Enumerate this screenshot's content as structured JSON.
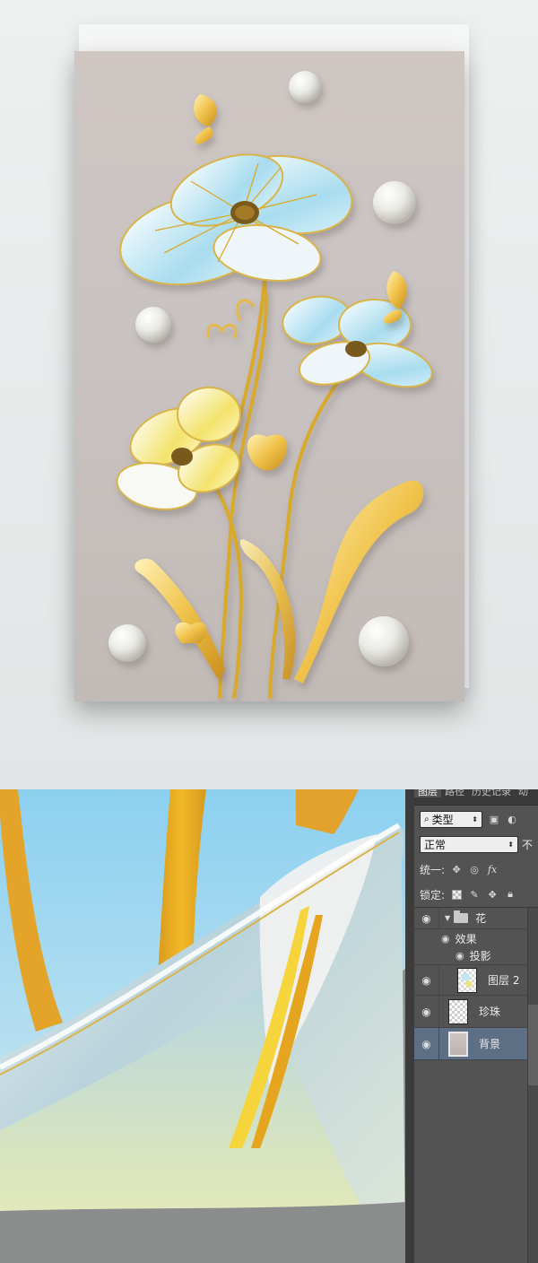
{
  "layers_panel": {
    "tabs": [
      "图层",
      "路径",
      "历史记录",
      "动"
    ],
    "filter": {
      "kind_label": "类型"
    },
    "blend": {
      "mode": "正常",
      "opacity_label": "不"
    },
    "unify_label": "统一:",
    "lock_label": "锁定:",
    "layers": {
      "group": {
        "name": "花"
      },
      "effects": {
        "name": "效果"
      },
      "shadow": {
        "name": "投影"
      },
      "layer2": {
        "name": "图层 2"
      },
      "pearl": {
        "name": "珍珠"
      },
      "background": {
        "name": "背景"
      }
    }
  },
  "icons": {
    "visibility": "eye-icon",
    "folder": "folder-icon",
    "search": "search-icon",
    "lock": "lock-icon",
    "fx": "fx-icon"
  },
  "colors": {
    "poster_bg": "#c9c3c2",
    "panel_bg": "#535353",
    "selected_layer": "#5d6f85",
    "gold": "#e7b93b",
    "petal_blue": "#a8dcef"
  }
}
